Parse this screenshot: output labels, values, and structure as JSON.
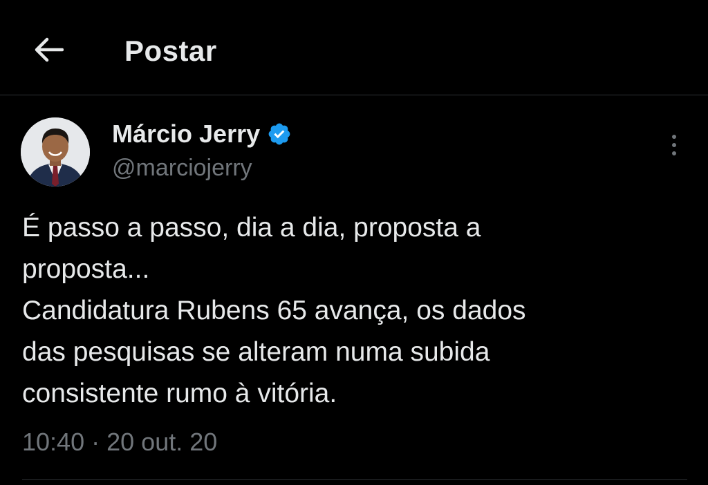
{
  "header": {
    "title": "Postar",
    "back_icon": "arrow-left-icon"
  },
  "post": {
    "author": {
      "name": "Márcio Jerry",
      "handle": "@marciojerry",
      "verified": true,
      "verified_color": "#1d9bf0",
      "avatar_icon": "profile-photo"
    },
    "text_lines": [
      "É passo a passo, dia a dia, proposta a",
      "proposta...",
      "Candidatura Rubens 65 avança, os dados",
      "das pesquisas se alteram numa subida",
      "consistente rumo à vitória."
    ],
    "time": "10:40",
    "separator": "·",
    "date": "20 out. 20",
    "more_icon": "more-vertical-icon"
  },
  "colors": {
    "background": "#000000",
    "text_primary": "#e7e9ea",
    "text_secondary": "#71767b",
    "divider": "#2f3336"
  }
}
